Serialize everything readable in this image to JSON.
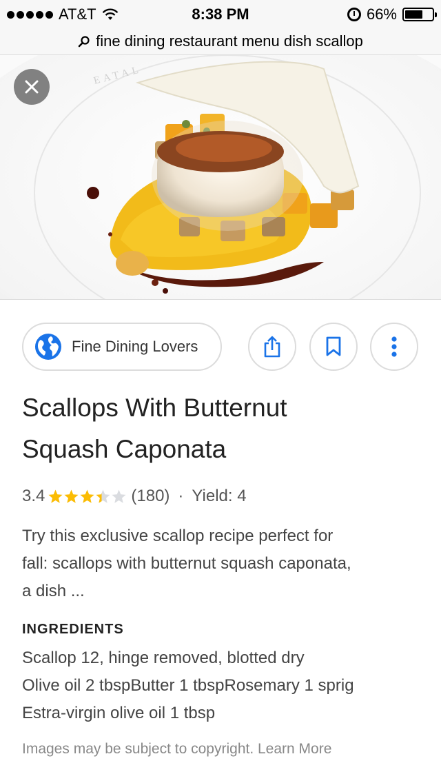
{
  "status_bar": {
    "carrier": "AT&T",
    "time": "8:38 PM",
    "battery": "66%",
    "battery_level": 0.66
  },
  "search": {
    "query": "fine dining restaurant menu  dish scallop"
  },
  "image": {
    "plate_text": "EATAL"
  },
  "source": {
    "name": "Fine Dining Lovers"
  },
  "recipe": {
    "title_line1": "Scallops With Butternut",
    "title_line2": "Squash Caponata",
    "rating": "3.4",
    "rating_value": 3.4,
    "rating_count": "(180)",
    "separator": "·",
    "yield": "Yield: 4",
    "description_line1": "Try this exclusive scallop recipe perfect for",
    "description_line2": "fall: scallops with butternut squash caponata,",
    "description_line3": "a dish ..."
  },
  "ingredients": {
    "heading": "INGREDIENTS",
    "line1": "Scallop 12, hinge removed, blotted dry",
    "line2": "Olive oil 2 tbspButter 1 tbspRosemary 1 sprig",
    "line3": "Estra-virgin olive oil 1 tbsp"
  },
  "footer": {
    "copyright": "Images may be subject to copyright. Learn More"
  },
  "colors": {
    "accent_blue": "#1a73e8",
    "star_gold": "#fbbc04",
    "star_empty": "#dadce0"
  }
}
